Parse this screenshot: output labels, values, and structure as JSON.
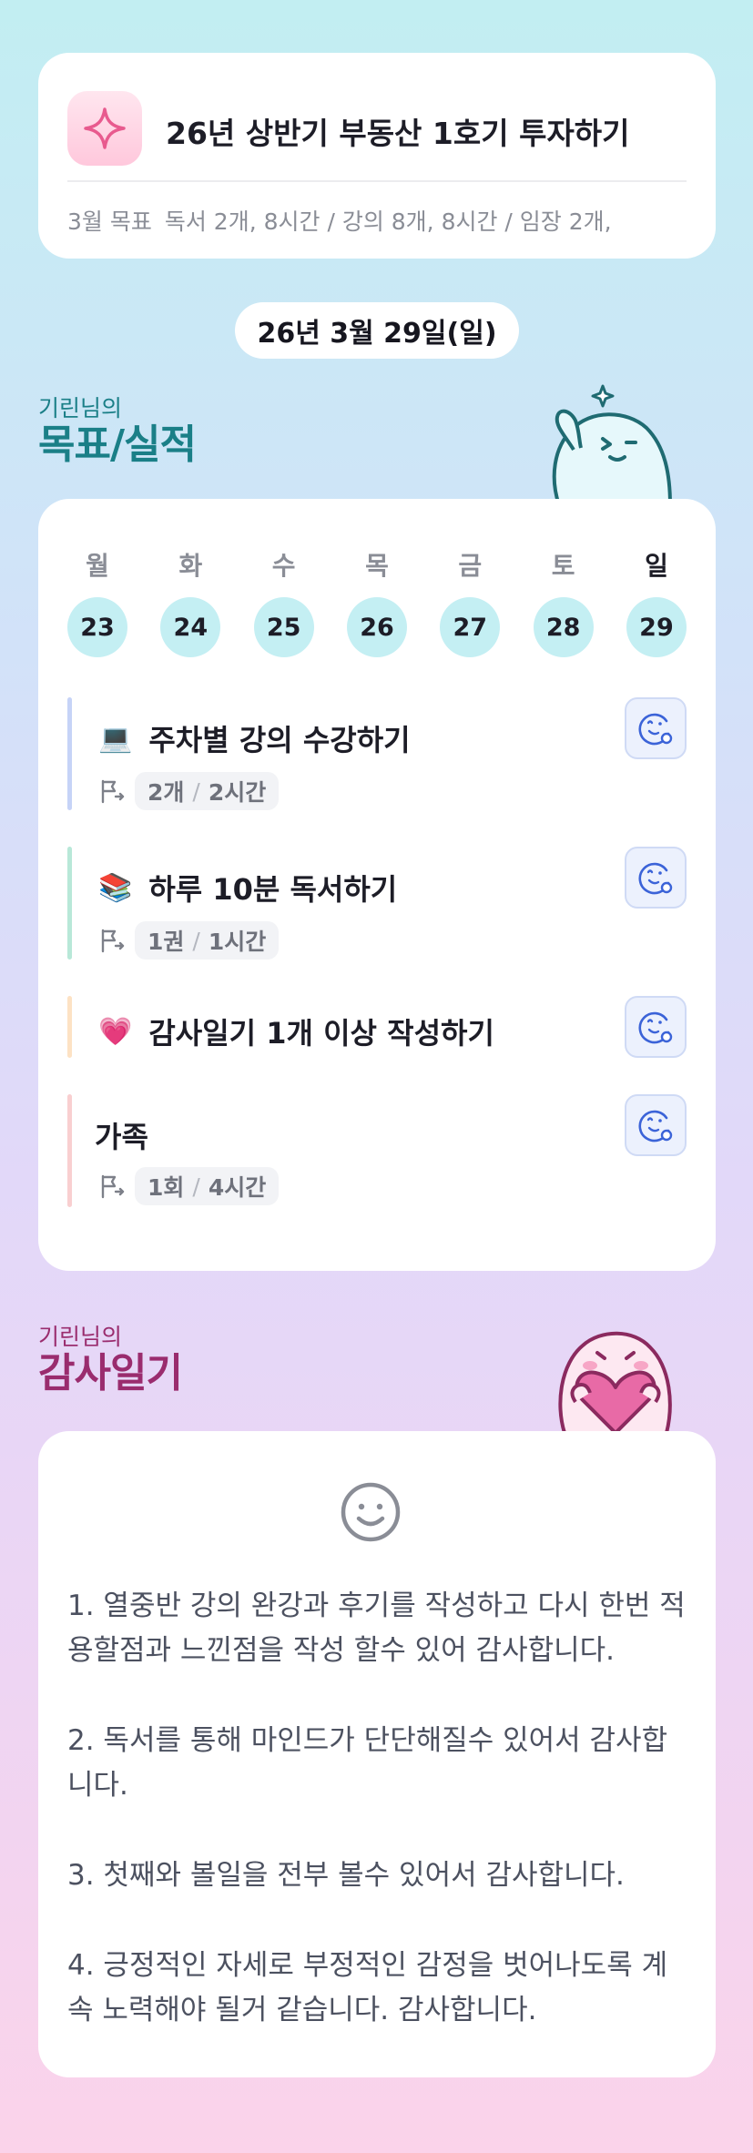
{
  "goal": {
    "title": "26년 상반기 부동산 1호기 투자하기",
    "month_label": "3월 목표",
    "month_text": "독서 2개, 8시간 / 강의 8개, 8시간 / 임장 2개,"
  },
  "date": "26년 3월 29일(일)",
  "goals_section": {
    "small": "기린님의",
    "big": "목표/실적"
  },
  "week": {
    "days": [
      {
        "label": "월",
        "num": "23"
      },
      {
        "label": "화",
        "num": "24"
      },
      {
        "label": "수",
        "num": "25"
      },
      {
        "label": "목",
        "num": "26"
      },
      {
        "label": "금",
        "num": "27"
      },
      {
        "label": "토",
        "num": "28"
      },
      {
        "label": "일",
        "num": "29"
      }
    ]
  },
  "tasks": [
    {
      "icon": "laptop-icon",
      "emoji": "💻",
      "title": "주차별 강의 수강하기",
      "count": "2개",
      "time": "2시간",
      "bar_color": "#c6d3f7"
    },
    {
      "icon": "books-icon",
      "emoji": "📚",
      "title": "하루 10분 독서하기",
      "count": "1권",
      "time": "1시간",
      "bar_color": "#b8e8d8"
    },
    {
      "icon": "heart-icon",
      "emoji": "💗",
      "title": "감사일기 1개 이상 작성하기",
      "bar_color": "#fde2c4"
    },
    {
      "icon": "",
      "emoji": "",
      "title": "가족",
      "count": "1회",
      "time": "4시간",
      "bar_color": "#f9cfd0"
    }
  ],
  "thanks_section": {
    "small": "기린님의",
    "big": "감사일기"
  },
  "thanks": {
    "entries": [
      "1. 열중반 강의 완강과 후기를 작성하고 다시 한번 적용할점과 느낀점을 작성 할수 있어 감사합니다.",
      "2. 독서를 통해 마인드가 단단해질수 있어서 감사합니다.",
      "3. 첫째와 볼일을 전부 볼수 있어서 감사합니다.",
      "4. 긍정적인 자세로 부정적인 감정을 벗어나도록 계속 노력해야 될거 같습니다. 감사합니다."
    ]
  },
  "colors": {
    "goals_accent": "#1a7f87",
    "thanks_accent": "#9a2c6e",
    "day_circle": "#c4eff3",
    "react_blue": "#3b63d8"
  }
}
